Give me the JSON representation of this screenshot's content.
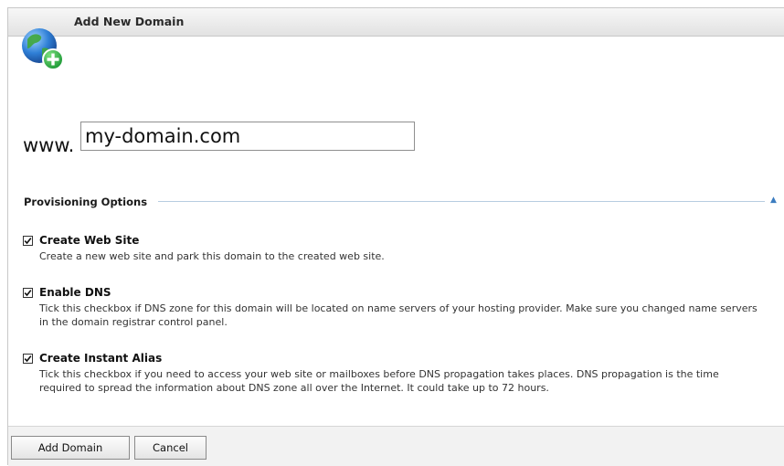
{
  "header": {
    "title": "Add New Domain",
    "icon": "globe-add-icon"
  },
  "domain": {
    "prefix": "www.",
    "value": "my-domain.com"
  },
  "provisioning": {
    "title": "Provisioning Options",
    "collapse_glyph": "▲",
    "options": [
      {
        "label": "Create Web Site",
        "checked": true,
        "description": "Create a new web site and park this domain to the created web site."
      },
      {
        "label": "Enable DNS",
        "checked": true,
        "description": "Tick this checkbox if DNS zone for this domain will be located on name servers of your hosting provider. Make sure you changed name servers in the domain registrar control panel."
      },
      {
        "label": "Create Instant Alias",
        "checked": true,
        "description": "Tick this checkbox if you need to access your web site or mailboxes before DNS propagation takes places. DNS propagation is the time required to spread the information about DNS zone all over the Internet. It could take up to 72 hours."
      }
    ]
  },
  "footer": {
    "add_label": "Add Domain",
    "cancel_label": "Cancel"
  },
  "colors": {
    "accent_line": "#b7cde0",
    "collapse_arrow": "#3b7cc0",
    "globe_plus": "#37b34a"
  }
}
